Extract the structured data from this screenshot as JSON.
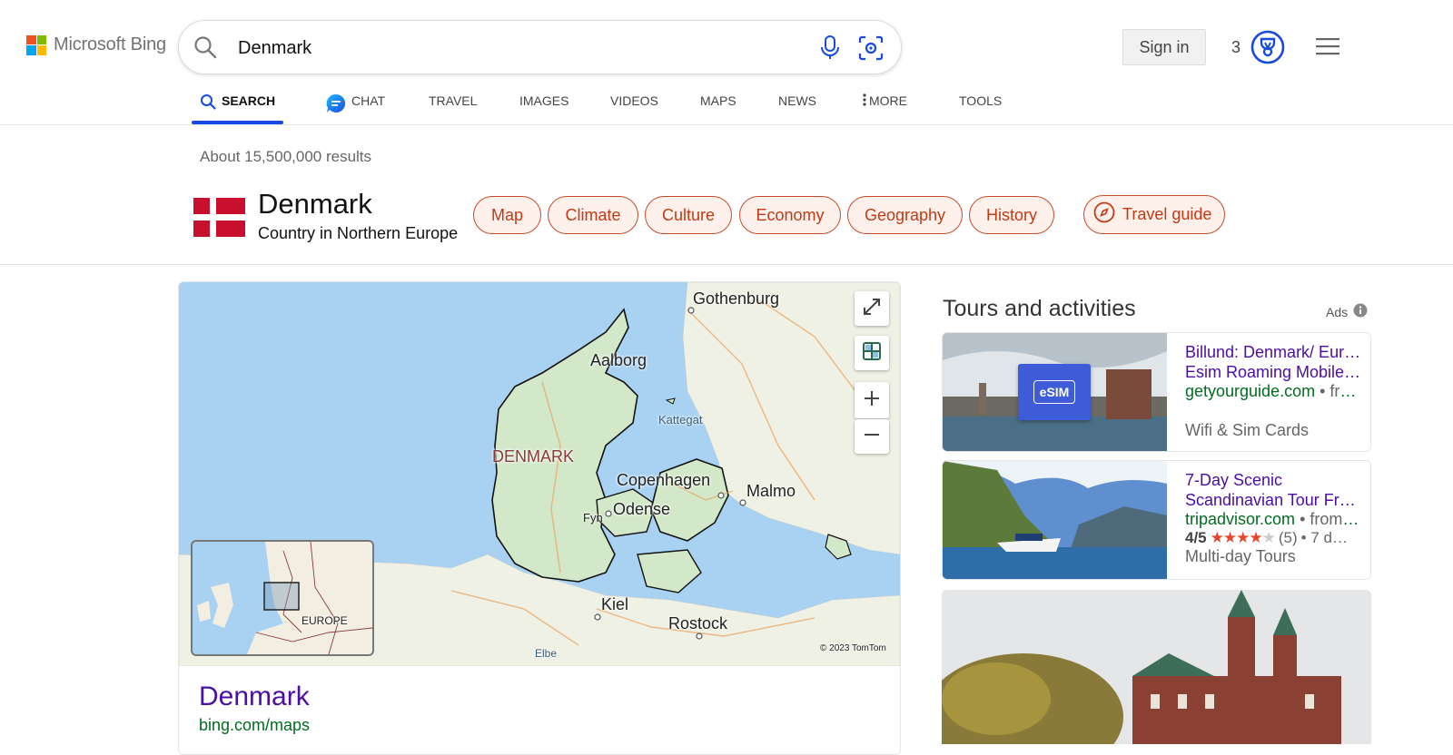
{
  "brand": {
    "name": "Microsoft Bing",
    "colors": [
      "#f25022",
      "#7fba00",
      "#00a4ef",
      "#ffb900"
    ]
  },
  "search": {
    "query": "Denmark",
    "placeholder": ""
  },
  "header": {
    "signin_label": "Sign in",
    "rewards_count": "3"
  },
  "nav": {
    "tabs": [
      {
        "label": "SEARCH",
        "icon": "search-icon",
        "active": true
      },
      {
        "label": "CHAT",
        "icon": "chat-icon"
      },
      {
        "label": "TRAVEL"
      },
      {
        "label": "IMAGES"
      },
      {
        "label": "VIDEOS"
      },
      {
        "label": "MAPS"
      },
      {
        "label": "NEWS"
      },
      {
        "label": "MORE",
        "icon": "more-vertical-icon"
      },
      {
        "label": "TOOLS"
      }
    ]
  },
  "results": {
    "count_text": "About 15,500,000 results"
  },
  "entity": {
    "title": "Denmark",
    "subtitle": "Country in Northern Europe",
    "flag_colors": [
      "#c8102e",
      "#ffffff"
    ],
    "pills": [
      "Map",
      "Climate",
      "Culture",
      "Economy",
      "Geography",
      "History"
    ],
    "travel_guide": "Travel guide",
    "accent": "#c33a14"
  },
  "map": {
    "labels": {
      "gothenburg": "Gothenburg",
      "aalborg": "Aalborg",
      "kattegat": "Kattegat",
      "denmark": "DENMARK",
      "copenhagen": "Copenhagen",
      "malmo": "Malmo",
      "fyn": "Fyn",
      "odense": "Odense",
      "kiel": "Kiel",
      "rostock": "Rostock",
      "elbe": "Elbe",
      "europe": "EUROPE"
    },
    "copyright": "© 2023 TomTom",
    "result_title": "Denmark",
    "result_url": "bing.com/maps"
  },
  "sidebar": {
    "title": "Tours and activities",
    "ads_label": "Ads",
    "ads": [
      {
        "title_line1": "Billund: Denmark/ Europe",
        "title_line2": "Esim Roaming Mobile…",
        "domain": "getyourguide.com",
        "domain_extra": "• fro…",
        "category": "Wifi & Sim Cards",
        "thumb_badge": "eSIM"
      },
      {
        "title_line1": "7-Day Scenic",
        "title_line2": "Scandinavian Tour Fro…",
        "domain": "tripadvisor.com",
        "domain_extra": "• from …",
        "rating": "4/5",
        "stars": 4,
        "reviews": "(5)",
        "duration": "• 7 d…",
        "category": "Multi-day Tours"
      }
    ]
  }
}
